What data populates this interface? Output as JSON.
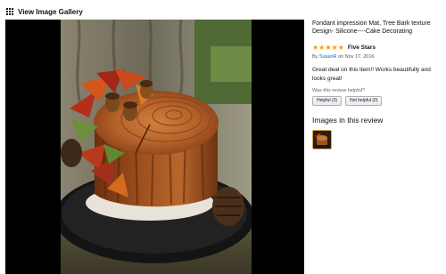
{
  "gallery": {
    "link_label": "View Image Gallery",
    "icon": "grid-icon"
  },
  "review": {
    "product_title": "Fondant impression Mat, Tree Bark texture Design- Silicone----Cake Decorating",
    "rating": 5,
    "rating_max": 5,
    "star_color": "#ff9900",
    "headline": "Five Stars",
    "by_prefix": "By",
    "author": "SusanR",
    "date_prefix": "on",
    "date": "Nov 17, 2016",
    "body": "Great deal on this item!! Works beautifully and looks great!",
    "helpful_question": "Was this review helpful?",
    "helpful_yes": "Helpful (3)",
    "helpful_no": "Not helpful (0)",
    "images_heading": "Images in this review"
  },
  "colors": {
    "link": "#0066c0",
    "viewer_bg": "#000000",
    "thumb_border": "#e0a54a"
  }
}
